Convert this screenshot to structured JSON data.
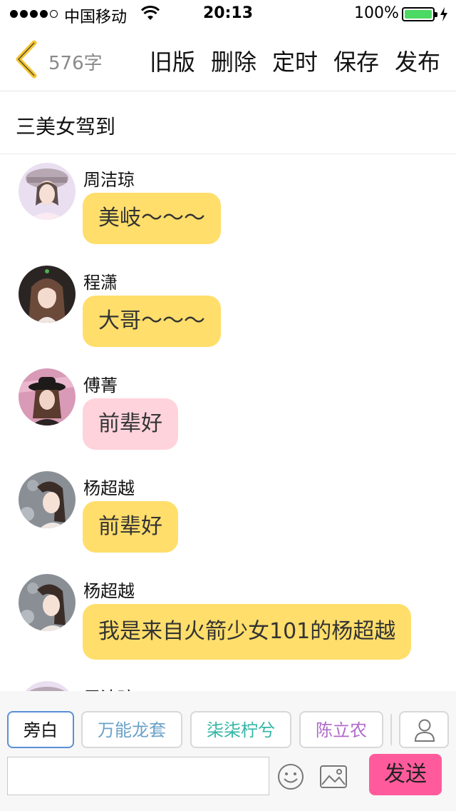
{
  "status_bar": {
    "carrier": "中国移动",
    "time": "20:13",
    "battery_percent": "100%",
    "battery_level": 1.0,
    "signal_bars": 4,
    "signal_max": 5
  },
  "nav": {
    "word_count": "576字",
    "actions": [
      "旧版",
      "删除",
      "定时",
      "保存",
      "发布"
    ]
  },
  "story_title": "三美女驾到",
  "messages": [
    {
      "sender": "周洁琼",
      "text": "美岐～～～",
      "bubble_color": "#ffde6b",
      "avatar": "avatar-zhoujieqiong"
    },
    {
      "sender": "程潇",
      "text": "大哥～～～",
      "bubble_color": "#ffde6b",
      "avatar": "avatar-chengxiao"
    },
    {
      "sender": "傅菁",
      "text": "前辈好",
      "bubble_color": "#ffd3dc",
      "avatar": "avatar-fujing"
    },
    {
      "sender": "杨超越",
      "text": "前辈好",
      "bubble_color": "#ffde6b",
      "avatar": "avatar-yangchaoyue"
    },
    {
      "sender": "杨超越",
      "text": "我是来自火箭少女101的杨超越",
      "bubble_color": "#ffde6b",
      "avatar": "avatar-yangchaoyue"
    },
    {
      "sender": "周洁琼",
      "text": "",
      "bubble_color": "#ffde6b",
      "avatar": "avatar-zhoujieqiong"
    }
  ],
  "character_chips": [
    {
      "label": "旁白",
      "color": "#111111",
      "active": true
    },
    {
      "label": "万能龙套",
      "color": "#6aa2c8",
      "active": false
    },
    {
      "label": "柒柒柠兮",
      "color": "#33b6a6",
      "active": false
    },
    {
      "label": "陈立农",
      "color": "#b06ac8",
      "active": false
    },
    {
      "label": "",
      "color": "#888888",
      "active": false
    }
  ],
  "input": {
    "value": "",
    "placeholder": ""
  },
  "send_label": "发送",
  "colors": {
    "yellow_bubble": "#ffde6b",
    "pink_bubble": "#ffd3dc",
    "send_button": "#ff5b9c",
    "back_arrow": "#f4c430",
    "battery": "#4cd964"
  }
}
